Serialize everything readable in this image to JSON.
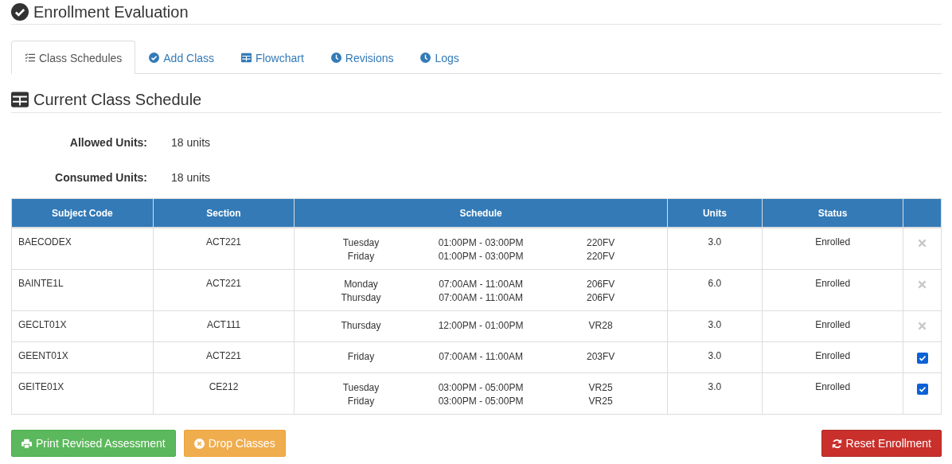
{
  "page_title": "Enrollment Evaluation",
  "tabs": [
    {
      "label": "Class Schedules",
      "kind": "schedules",
      "selected": true
    },
    {
      "label": "Add Class",
      "kind": "add",
      "selected": false
    },
    {
      "label": "Flowchart",
      "kind": "flowchart",
      "selected": false
    },
    {
      "label": "Revisions",
      "kind": "revisions",
      "selected": false
    },
    {
      "label": "Logs",
      "kind": "logs",
      "selected": false
    }
  ],
  "section_title": "Current Class Schedule",
  "summary": [
    {
      "label": "Allowed Units:",
      "value": "18 units"
    },
    {
      "label": "Consumed Units:",
      "value": "18 units"
    }
  ],
  "table": {
    "columns": [
      "Subject Code",
      "Section",
      "Schedule",
      "Units",
      "Status"
    ],
    "rows": [
      {
        "subject_code": "BAECODEX",
        "section": "ACT221",
        "schedule": [
          {
            "day": "Tuesday",
            "time": "01:00PM - 03:00PM",
            "room": "220FV"
          },
          {
            "day": "Friday",
            "time": "01:00PM - 03:00PM",
            "room": "220FV"
          }
        ],
        "units": "3.0",
        "status": "Enrolled",
        "action": {
          "kind": "remove"
        }
      },
      {
        "subject_code": "BAINTE1L",
        "section": "ACT221",
        "schedule": [
          {
            "day": "Monday",
            "time": "07:00AM - 11:00AM",
            "room": "206FV"
          },
          {
            "day": "Thursday",
            "time": "07:00AM - 11:00AM",
            "room": "206FV"
          }
        ],
        "units": "6.0",
        "status": "Enrolled",
        "action": {
          "kind": "remove"
        }
      },
      {
        "subject_code": "GECLT01X",
        "section": "ACT111",
        "schedule": [
          {
            "day": "Thursday",
            "time": "12:00PM - 01:00PM",
            "room": "VR28"
          }
        ],
        "units": "3.0",
        "status": "Enrolled",
        "action": {
          "kind": "remove"
        }
      },
      {
        "subject_code": "GEENT01X",
        "section": "ACT221",
        "schedule": [
          {
            "day": "Friday",
            "time": "07:00AM - 11:00AM",
            "room": "203FV"
          }
        ],
        "units": "3.0",
        "status": "Enrolled",
        "action": {
          "kind": "checkbox",
          "checked": true
        }
      },
      {
        "subject_code": "GEITE01X",
        "section": "CE212",
        "schedule": [
          {
            "day": "Tuesday",
            "time": "03:00PM - 05:00PM",
            "room": "VR25"
          },
          {
            "day": "Friday",
            "time": "03:00PM - 05:00PM",
            "room": "VR25"
          }
        ],
        "units": "3.0",
        "status": "Enrolled",
        "action": {
          "kind": "checkbox",
          "checked": true
        }
      }
    ]
  },
  "buttons": [
    {
      "label": "Print Revised Assessment",
      "kind": "print"
    },
    {
      "label": "Drop Classes",
      "kind": "drop"
    },
    {
      "label": "Reset Enrollment",
      "kind": "reset"
    }
  ]
}
